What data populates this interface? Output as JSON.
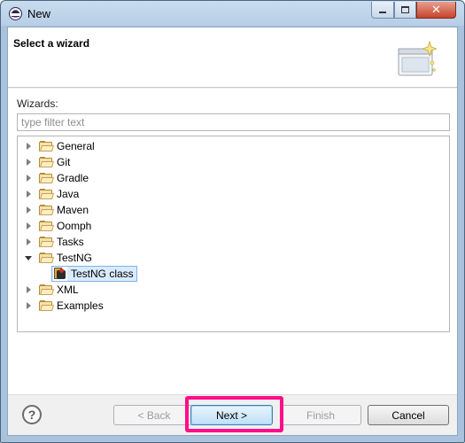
{
  "window": {
    "title": "New"
  },
  "banner": {
    "title": "Select a wizard"
  },
  "wizards": {
    "label": "Wizards:",
    "filter_placeholder": "type filter text",
    "tree": [
      {
        "label": "General",
        "expanded": false,
        "icon": "folder-icon"
      },
      {
        "label": "Git",
        "expanded": false,
        "icon": "folder-icon"
      },
      {
        "label": "Gradle",
        "expanded": false,
        "icon": "folder-icon"
      },
      {
        "label": "Java",
        "expanded": false,
        "icon": "folder-icon"
      },
      {
        "label": "Maven",
        "expanded": false,
        "icon": "folder-icon"
      },
      {
        "label": "Oomph",
        "expanded": false,
        "icon": "folder-icon"
      },
      {
        "label": "Tasks",
        "expanded": false,
        "icon": "folder-icon"
      },
      {
        "label": "TestNG",
        "expanded": true,
        "icon": "folder-icon",
        "children": [
          {
            "label": "TestNG class",
            "selected": true,
            "icon": "testng-icon"
          }
        ]
      },
      {
        "label": "XML",
        "expanded": false,
        "icon": "folder-icon"
      },
      {
        "label": "Examples",
        "expanded": false,
        "icon": "folder-icon"
      }
    ]
  },
  "buttons": {
    "help": "?",
    "back": "< Back",
    "next": "Next >",
    "finish": "Finish",
    "cancel": "Cancel"
  },
  "colors": {
    "highlight": "#ff0d89",
    "selection": "#d9ebfc",
    "title_bar": "#b7cee6"
  }
}
